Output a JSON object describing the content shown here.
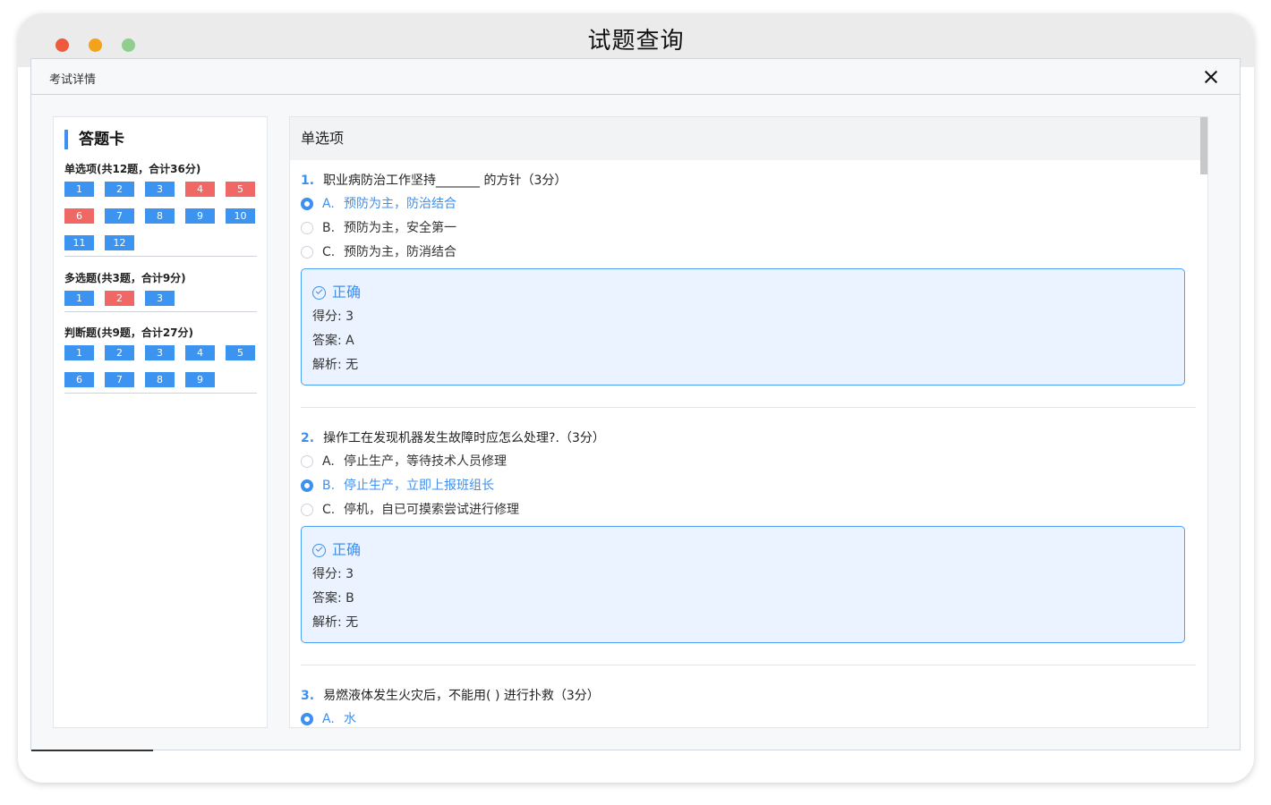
{
  "window": {
    "title": "试题查询"
  },
  "dialog": {
    "title": "考试详情"
  },
  "answer_card": {
    "title": "答题卡",
    "sections": [
      {
        "title": "单选项(共12题，合计36分)",
        "items": [
          {
            "label": "1",
            "status": "correct"
          },
          {
            "label": "2",
            "status": "correct"
          },
          {
            "label": "3",
            "status": "correct"
          },
          {
            "label": "4",
            "status": "wrong"
          },
          {
            "label": "5",
            "status": "wrong"
          },
          {
            "label": "6",
            "status": "wrong"
          },
          {
            "label": "7",
            "status": "correct"
          },
          {
            "label": "8",
            "status": "correct"
          },
          {
            "label": "9",
            "status": "correct"
          },
          {
            "label": "10",
            "status": "correct"
          },
          {
            "label": "11",
            "status": "correct"
          },
          {
            "label": "12",
            "status": "correct"
          }
        ]
      },
      {
        "title": "多选题(共3题，合计9分)",
        "items": [
          {
            "label": "1",
            "status": "correct"
          },
          {
            "label": "2",
            "status": "wrong"
          },
          {
            "label": "3",
            "status": "correct"
          }
        ]
      },
      {
        "title": "判断题(共9题，合计27分)",
        "items": [
          {
            "label": "1",
            "status": "correct"
          },
          {
            "label": "2",
            "status": "correct"
          },
          {
            "label": "3",
            "status": "correct"
          },
          {
            "label": "4",
            "status": "correct"
          },
          {
            "label": "5",
            "status": "correct"
          },
          {
            "label": "6",
            "status": "correct"
          },
          {
            "label": "7",
            "status": "correct"
          },
          {
            "label": "8",
            "status": "correct"
          },
          {
            "label": "9",
            "status": "correct"
          }
        ]
      }
    ]
  },
  "main": {
    "section_title": "单选项",
    "questions": [
      {
        "num": "1.",
        "text": "职业病防治工作坚持_______ 的方针（3分）",
        "options": [
          {
            "letter": "A.",
            "text": "预防为主，防治结合",
            "selected": true
          },
          {
            "letter": "B.",
            "text": "预防为主，安全第一",
            "selected": false
          },
          {
            "letter": "C.",
            "text": "预防为主，防消结合",
            "selected": false
          }
        ],
        "result": {
          "status": "正确",
          "score": "得分: 3",
          "answer": "答案: A",
          "analysis": "解析: 无"
        }
      },
      {
        "num": "2.",
        "text": "操作工在发现机器发生故障时应怎么处理?.（3分）",
        "options": [
          {
            "letter": "A.",
            "text": "停止生产，等待技术人员修理",
            "selected": false
          },
          {
            "letter": "B.",
            "text": "停止生产，立即上报班组长",
            "selected": true
          },
          {
            "letter": "C.",
            "text": "停机，自已可摸索尝试进行修理",
            "selected": false
          }
        ],
        "result": {
          "status": "正确",
          "score": "得分: 3",
          "answer": "答案: B",
          "analysis": "解析: 无"
        }
      },
      {
        "num": "3.",
        "text": "易燃液体发生火灾后，不能用( ) 进行扑救（3分）",
        "options": [
          {
            "letter": "A.",
            "text": "水",
            "selected": true
          }
        ]
      }
    ]
  },
  "colors": {
    "accent": "#3d8ff0",
    "correct": "#3d93f0",
    "wrong": "#ef6866"
  }
}
